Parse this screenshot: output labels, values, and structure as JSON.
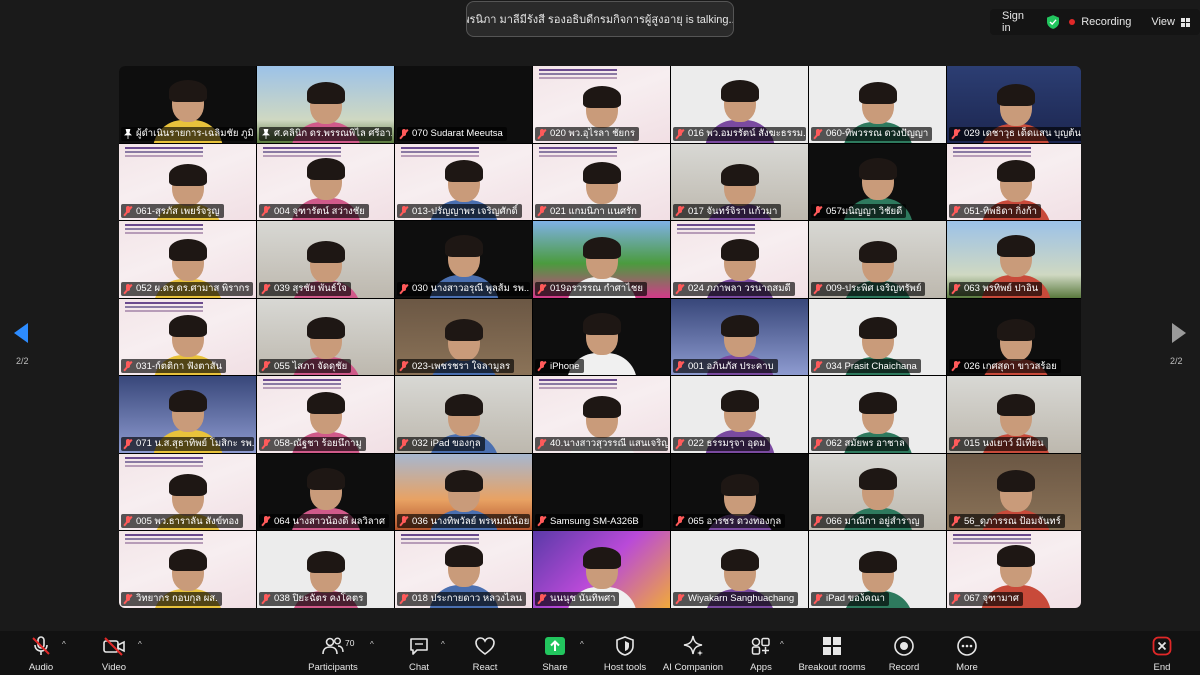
{
  "talking_banner": "พรนิภา มาลีมีรังสี รองอธิบดีกรมกิจการผู้สูงอายุ is talking...",
  "top_right": {
    "sign_in": "Sign in",
    "recording": "Recording",
    "view": "View"
  },
  "page_indicator": {
    "left": "2/2",
    "right": "2/2"
  },
  "participants": [
    {
      "label": "ผู้ดำเนินรายการ-เฉลิมชัย ภูมิ...",
      "muted": false,
      "bg": "black"
    },
    {
      "label": "ศ.คลินิก ดร.พรรณพิไล ศรีอา...",
      "muted": false,
      "bg": "sky"
    },
    {
      "label": "070 Sudarat Meeutsa",
      "muted": true,
      "bg": "black"
    },
    {
      "label": "020 พว.อุไรลา ชัยกร",
      "muted": true,
      "bg": "slide"
    },
    {
      "label": "016 พว.อมรรัตน์ สังฆะธรรม...",
      "muted": true,
      "bg": "white"
    },
    {
      "label": "060-ทิพวรรณ ดวงปัญญา",
      "muted": true,
      "bg": "white"
    },
    {
      "label": "029 เดชาวุธ เด็ดแสน บุญต้น ...",
      "muted": true,
      "bg": "blue"
    },
    {
      "label": "061-สุรภัส เพยร์จรูญ",
      "muted": true,
      "bg": "slide"
    },
    {
      "label": "004 จุฑารัตน์ สว่างชัย",
      "muted": true,
      "bg": "slide"
    },
    {
      "label": "013-ปรัญญาพร เจริญศักดิ์",
      "muted": true,
      "bg": "slide"
    },
    {
      "label": "021 แกมนิภา แนศรัก",
      "muted": true,
      "bg": "slide"
    },
    {
      "label": "017 จันทร์จิรา แก้วมา",
      "muted": true,
      "bg": "office"
    },
    {
      "label": "057มนิญญา วิชัยดี",
      "muted": true,
      "bg": "black"
    },
    {
      "label": "051-ทิพธิดา กิ่งก้า",
      "muted": true,
      "bg": "slide"
    },
    {
      "label": "052 ผ.ดร.ดร.ศามาส พิรากร",
      "muted": true,
      "bg": "slide"
    },
    {
      "label": "039 สุรชัย พันธ์ใจ",
      "muted": true,
      "bg": "office"
    },
    {
      "label": "030 นางสาวอรุณี พูลส้ม รพ....",
      "muted": true,
      "bg": "black"
    },
    {
      "label": "019อรวรรณ กำศาไชย",
      "muted": true,
      "bg": "garden"
    },
    {
      "label": "024 ภภาพลา วรนาถสมดี",
      "muted": true,
      "bg": "slide"
    },
    {
      "label": "009-ประพิศ เจริญทรัพย์",
      "muted": true,
      "bg": "office"
    },
    {
      "label": "063 พรทิพย์ ปาอิน",
      "muted": true,
      "bg": "sky"
    },
    {
      "label": "031-ก์ตติกา ฟังตาสัน",
      "muted": true,
      "bg": "slide"
    },
    {
      "label": "055 ไสภา จัดดุชัย",
      "muted": true,
      "bg": "office"
    },
    {
      "label": "023-เพชรชรา ใจลามูลร",
      "muted": true,
      "bg": "wood"
    },
    {
      "label": "iPhone",
      "muted": true,
      "bg": "black"
    },
    {
      "label": "001 อภินภัส ประคาบ",
      "muted": true,
      "bg": "nav"
    },
    {
      "label": "034 Prasit Chaichana",
      "muted": true,
      "bg": "white"
    },
    {
      "label": "026 เกศสุดา ขาวสร้อย",
      "muted": true,
      "bg": "black"
    },
    {
      "label": "071 น.ส.สุธาทิพย์ โมสิกะ รพ...",
      "muted": true,
      "bg": "nav"
    },
    {
      "label": "058-ณัฐชา ร้อยนึกามู",
      "muted": true,
      "bg": "slide"
    },
    {
      "label": "032 iPad ของกุล",
      "muted": true,
      "bg": "office"
    },
    {
      "label": "40.นางสาวสุวรรณี แสนเจริญ...",
      "muted": true,
      "bg": "slide"
    },
    {
      "label": "022 ธรรมรุจา อุดม",
      "muted": true,
      "bg": "white"
    },
    {
      "label": "062 สมัยพร อาชาล",
      "muted": true,
      "bg": "white"
    },
    {
      "label": "015 นงเยาว์ มีเที่ยน",
      "muted": true,
      "bg": "office"
    },
    {
      "label": "005 พว.ธาราลัน สังข์ทอง",
      "muted": true,
      "bg": "slide"
    },
    {
      "label": "064 นางสาวน้องดี ผลวิลาศ",
      "muted": true,
      "bg": "black"
    },
    {
      "label": "036 นางทิพวัลย์ พรหมณ์น้อย",
      "muted": true,
      "bg": "sunset"
    },
    {
      "label": "Samsung SM-A326B",
      "muted": true,
      "bg": "black"
    },
    {
      "label": "065 อารชร ดวงทองกุล",
      "muted": true,
      "bg": "black"
    },
    {
      "label": "066 มาณีกา อยู่สำราญ",
      "muted": true,
      "bg": "office"
    },
    {
      "label": "56_ดุภารรณ ป้อมจันทร์",
      "muted": true,
      "bg": "wood"
    },
    {
      "label": "วิทยากร กอบกุล ผส.",
      "muted": true,
      "bg": "slide"
    },
    {
      "label": "038 ปิยะฉัตร คงโคตร",
      "muted": true,
      "bg": "white"
    },
    {
      "label": "018 ประกายดาว หลวงไลน",
      "muted": true,
      "bg": "slide"
    },
    {
      "label": "นนนุช นันทิพศา",
      "muted": true,
      "bg": "purple"
    },
    {
      "label": "Wiyakarn Sanghuachang",
      "muted": true,
      "bg": "white"
    },
    {
      "label": "iPad ของ้คณา",
      "muted": true,
      "bg": "white"
    },
    {
      "label": "067 จุฑามาศ",
      "muted": true,
      "bg": "slide"
    }
  ],
  "toolbar": {
    "audio": "Audio",
    "video": "Video",
    "participants": "Participants",
    "participants_count": "70",
    "chat": "Chat",
    "react": "React",
    "share": "Share",
    "host_tools": "Host tools",
    "ai_companion": "AI Companion",
    "apps": "Apps",
    "breakout_rooms": "Breakout rooms",
    "record": "Record",
    "more": "More",
    "end": "End"
  },
  "colors": {
    "share_green": "#22c55e",
    "end_red": "#e02828",
    "recording_red": "#e02828",
    "shield_green": "#22c55e"
  }
}
